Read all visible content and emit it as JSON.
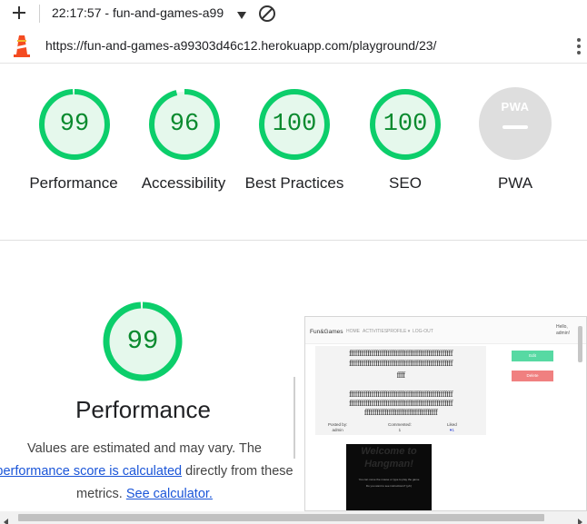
{
  "toolbar": {
    "title": "22:17:57 - fun-and-games-a99"
  },
  "address_bar": {
    "url": "https://fun-and-games-a99303d46c12.herokuapp.com/playground/23/"
  },
  "scores": [
    {
      "label": "Performance",
      "value": "99",
      "score": 0.99
    },
    {
      "label": "Accessibility",
      "value": "96",
      "score": 0.96
    },
    {
      "label": "Best Practices",
      "value": "100",
      "score": 1.0
    },
    {
      "label": "SEO",
      "value": "100",
      "score": 1.0
    }
  ],
  "pwa": {
    "label": "PWA",
    "badge_text": "PWA"
  },
  "performance_detail": {
    "score": "99",
    "title": "Performance",
    "text_before": "Values are estimated and may vary. The ",
    "link_score": "performance score is calculated",
    "text_middle": " directly from these metrics. ",
    "link_calc": "See calculator."
  },
  "screenshot": {
    "brand": "Fun&Games",
    "menu": [
      "HOME",
      "ACTIVITIES",
      "PROFILE ▾",
      "LOG-OUT"
    ],
    "hello": "Hello,",
    "user": "admin!",
    "lines": [
      "fffffffffffffffffffffffffffffffffffffffffffffffffff",
      "fffffffffffffffffffffffffffffffffffffffffffffffffff",
      "ffff",
      "fffffffffffffffffffffffffffffffffffffffffffffffffff",
      "fffffffffffffffffffffffffffffffffffffffffffffffffff",
      "ffffffffffffffffffffffffffffffffffff"
    ],
    "posted_by_label": "Posted by:",
    "posted_by": "admin",
    "commented_label": "Commented:",
    "commented": "1",
    "liked_label": "Liked",
    "liked": "♥1",
    "edit": "Edit",
    "delete": "Delete",
    "game_title_1": "Welcome to",
    "game_title_2": "Hangman!",
    "game_line_1": "You can move the mouse or type to play the game",
    "game_line_2": "Do you want to see instructions? (y/n)"
  },
  "colors": {
    "good": "#0cce6b",
    "good_text": "#0a8a2e",
    "good_fill": "#e5f8ec",
    "pwa_grey": "#dedede",
    "link": "#1a55d8"
  }
}
